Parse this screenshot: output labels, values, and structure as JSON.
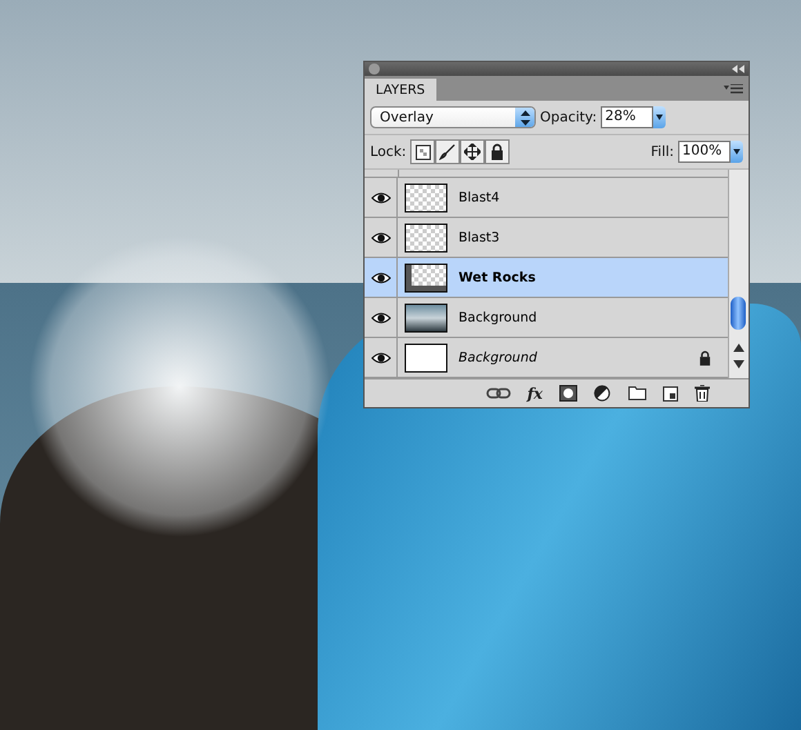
{
  "panel": {
    "tab": {
      "label": "LAYERS",
      "selected": true
    },
    "blend_mode": "Overlay",
    "opacity_label": "Opacity:",
    "opacity": "28%",
    "lock_label": "Lock:",
    "fill_label": "Fill:",
    "fill": "100%",
    "effects_label": "fx"
  },
  "layers": [
    {
      "name": "Blast4",
      "kind": "transparent",
      "visible": true,
      "selected": false,
      "locked": false
    },
    {
      "name": "Blast3",
      "kind": "transparent",
      "visible": true,
      "selected": false,
      "locked": false
    },
    {
      "name": "Wet Rocks",
      "kind": "rocks",
      "visible": true,
      "selected": true,
      "locked": false
    },
    {
      "name": "Background",
      "kind": "photo",
      "visible": true,
      "selected": false,
      "locked": false
    },
    {
      "name": "Background",
      "kind": "white",
      "visible": true,
      "selected": false,
      "locked": true
    }
  ]
}
